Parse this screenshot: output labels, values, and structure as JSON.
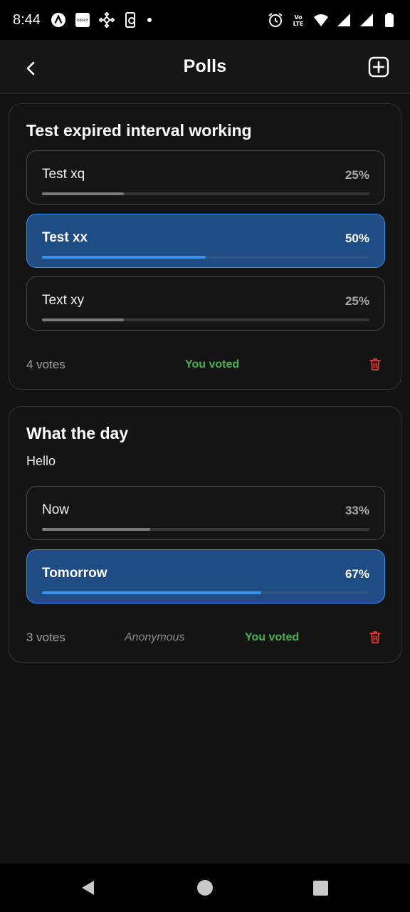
{
  "status_bar": {
    "time": "8:44",
    "icons": [
      "arc-icon",
      "blinkit-icon",
      "binance-icon",
      "phone-sync-icon",
      "dot-icon",
      "alarm-icon",
      "volte-icon",
      "wifi-icon",
      "signal-icon",
      "signal-icon",
      "battery-icon"
    ],
    "blinkit_text": "blinkit",
    "volte_text": "Vo LTE"
  },
  "header": {
    "title": "Polls",
    "back_icon": "chevron-left-icon",
    "add_icon": "plus-square-icon"
  },
  "polls": [
    {
      "title": "Test expired interval working",
      "description": "",
      "options": [
        {
          "label": "Test xq",
          "percent_text": "25%",
          "percent": 25,
          "selected": false
        },
        {
          "label": "Test xx",
          "percent_text": "50%",
          "percent": 50,
          "selected": true
        },
        {
          "label": "Text xy",
          "percent_text": "25%",
          "percent": 25,
          "selected": false
        }
      ],
      "votes": "4 votes",
      "anonymous": "",
      "voted": "You voted"
    },
    {
      "title": "What the day",
      "description": "Hello",
      "options": [
        {
          "label": "Now",
          "percent_text": "33%",
          "percent": 33,
          "selected": false
        },
        {
          "label": "Tomorrow",
          "percent_text": "67%",
          "percent": 67,
          "selected": true
        }
      ],
      "votes": "3 votes",
      "anonymous": "Anonymous",
      "voted": "You voted"
    }
  ],
  "colors": {
    "accent": "#3596f5",
    "selected_bg": "#1e4c83",
    "voted_green": "#4caf50",
    "delete_red": "#e53935",
    "background": "#121212"
  }
}
